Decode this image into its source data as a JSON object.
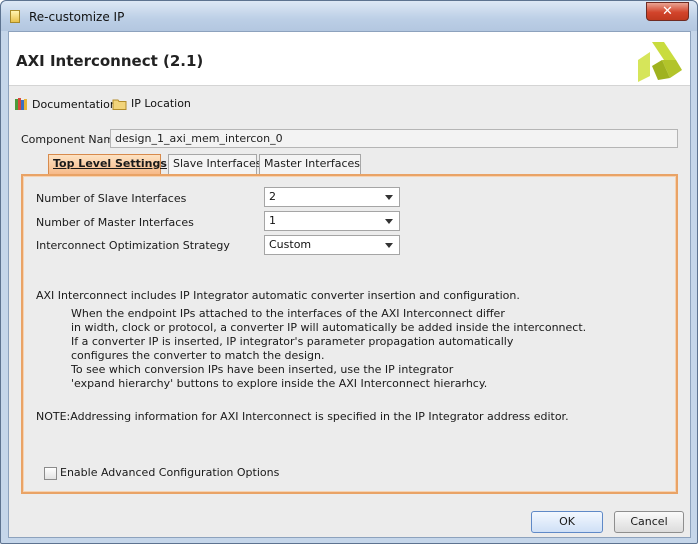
{
  "window": {
    "title": "Re-customize IP",
    "close_glyph": "✕"
  },
  "header": {
    "ip_title": "AXI Interconnect (2.1)"
  },
  "toolbar": {
    "documentation_label": "Documentation",
    "ip_location_label": "IP Location"
  },
  "component": {
    "label": "Component Name",
    "value": "design_1_axi_mem_intercon_0"
  },
  "tabs": [
    {
      "label": "Top Level Settings",
      "active": true
    },
    {
      "label": "Slave Interfaces",
      "active": false
    },
    {
      "label": "Master Interfaces",
      "active": false
    }
  ],
  "settings": {
    "num_slave": {
      "label": "Number of Slave Interfaces",
      "value": "2"
    },
    "num_master": {
      "label": "Number of Master Interfaces",
      "value": "1"
    },
    "strategy": {
      "label": "Interconnect Optimization Strategy",
      "value": "Custom"
    }
  },
  "description": {
    "intro": "AXI Interconnect includes IP Integrator automatic converter insertion and configuration.",
    "lines": [
      "When the endpoint IPs attached to the interfaces of the AXI Interconnect differ",
      "in width, clock or protocol, a converter IP will automatically be added inside the interconnect.",
      "If a converter IP is inserted, IP integrator's parameter propagation automatically",
      "configures the converter to match the design.",
      "To see which conversion IPs have been inserted, use the IP integrator",
      "'expand hierarchy' buttons to explore inside the AXI Interconnect hierarhcy."
    ],
    "note": "NOTE:Addressing information for AXI Interconnect is specified in the IP Integrator address editor."
  },
  "advanced": {
    "label": "Enable Advanced Configuration Options",
    "checked": false
  },
  "buttons": {
    "ok": "OK",
    "cancel": "Cancel"
  },
  "colors": {
    "tab_accent": "#e9a366",
    "title_bar": "#c5d6ea",
    "close": "#d2442b"
  }
}
